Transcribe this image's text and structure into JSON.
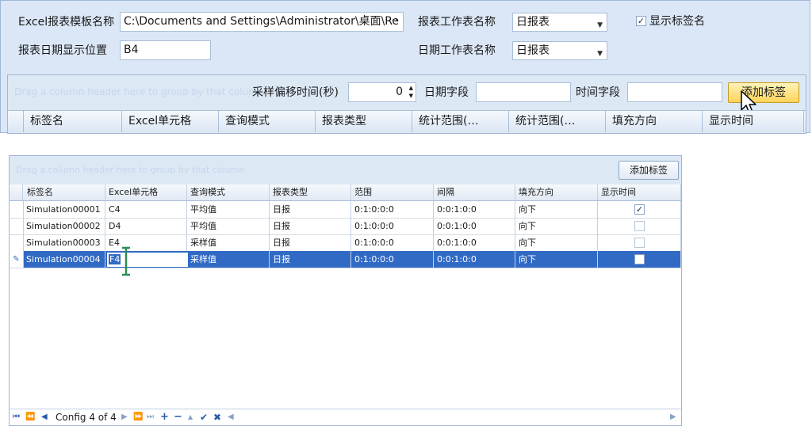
{
  "top_form": {
    "template_label": "Excel报表模板名称",
    "template_path": "C:\\Documents and Settings\\Administrator\\桌面\\Re",
    "browse_label": "···",
    "worksheet_label": "报表工作表名称",
    "worksheet_value": "日报表",
    "show_tag_name_label": "显示标签名",
    "show_tag_name_checked": true,
    "date_pos_label": "报表日期显示位置",
    "date_pos_value": "B4",
    "date_sheet_label": "日期工作表名称",
    "date_sheet_value": "日报表"
  },
  "sampling_bar": {
    "ghost_text": "Drag a column header here to group by that column",
    "offset_label": "采样偏移时间(秒)",
    "offset_value": "0",
    "date_field_label": "日期字段",
    "date_field_value": "",
    "time_field_label": "时间字段",
    "time_field_value": "",
    "add_tag_label": "添加标签"
  },
  "top_grid_headers": [
    "标签名",
    "Excel单元格",
    "查询模式",
    "报表类型",
    "统计范围(…",
    "统计范围(…",
    "填充方向",
    "显示时间"
  ],
  "bottom_grid": {
    "ghost_text": "Drag a column header here to group by that column",
    "add_tag_label": "添加标签",
    "headers": [
      "标签名",
      "Excel单元格",
      "查询模式",
      "报表类型",
      "范围",
      "间隔",
      "填充方向",
      "显示时间"
    ],
    "rows": [
      {
        "tag": "Simulation00001",
        "cell": "C4",
        "mode": "平均值",
        "type": "日报",
        "range": "0:1:0:0:0",
        "interval": "0:0:1:0:0",
        "fill": "向下",
        "show_time": true
      },
      {
        "tag": "Simulation00002",
        "cell": "D4",
        "mode": "平均值",
        "type": "日报",
        "range": "0:1:0:0:0",
        "interval": "0:0:1:0:0",
        "fill": "向下",
        "show_time": false
      },
      {
        "tag": "Simulation00003",
        "cell": "E4",
        "mode": "采样值",
        "type": "日报",
        "range": "0:1:0:0:0",
        "interval": "0:0:1:0:0",
        "fill": "向下",
        "show_time": false
      },
      {
        "tag": "Simulation00004",
        "cell": "F4",
        "mode": "采样值",
        "type": "日报",
        "range": "0:1:0:0:0",
        "interval": "0:0:1:0:0",
        "fill": "向下",
        "show_time": false
      }
    ],
    "navigator_text": "Config 4 of 4"
  },
  "colors": {
    "selection": "#316ac5",
    "panel": "#dbe7f6",
    "accent_button": "#ffd35a"
  }
}
